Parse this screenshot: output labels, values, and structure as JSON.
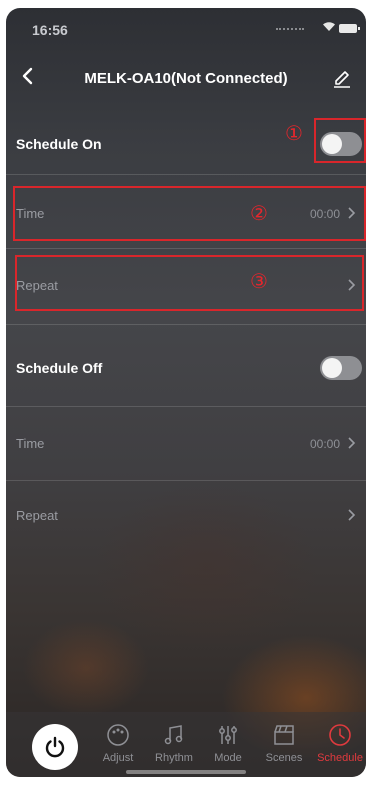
{
  "status_bar": {
    "time": "16:56"
  },
  "header": {
    "title": "MELK-OA10(Not Connected)"
  },
  "schedule_on": {
    "label": "Schedule On",
    "toggle_on": false,
    "time_label": "Time",
    "time_value": "00:00",
    "repeat_label": "Repeat"
  },
  "schedule_off": {
    "label": "Schedule Off",
    "toggle_on": false,
    "time_label": "Time",
    "time_value": "00:00",
    "repeat_label": "Repeat"
  },
  "annotations": [
    "①",
    "②",
    "③"
  ],
  "annotation_color": "#d9262b",
  "tabs": [
    {
      "label": "Adjust",
      "icon": "palette-icon"
    },
    {
      "label": "Rhythm",
      "icon": "music-note-icon"
    },
    {
      "label": "Mode",
      "icon": "sliders-icon"
    },
    {
      "label": "Scenes",
      "icon": "clapperboard-icon"
    },
    {
      "label": "Schedule",
      "icon": "clock-icon",
      "active": true
    }
  ],
  "active_color": "#e03a3e"
}
